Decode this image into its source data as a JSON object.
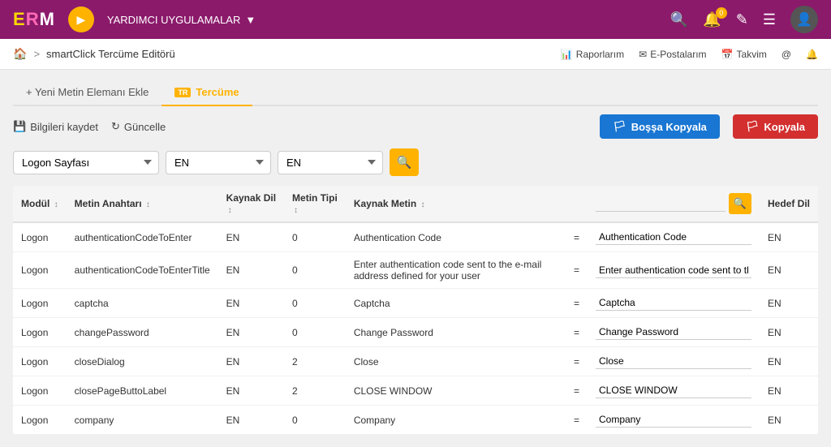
{
  "topnav": {
    "logo": "ERM",
    "yardimci": "YARDIMCI UYGULAMALAR",
    "icons": [
      "search",
      "bell",
      "pencil",
      "menu",
      "user"
    ],
    "bell_badge": "0"
  },
  "breadcrumb": {
    "home": "🏠",
    "sep": ">",
    "crumb": "smartClick Tercüme Editörü",
    "actions": [
      "Raporlarım",
      "E-Postalarım",
      "Takvim"
    ]
  },
  "tabs": [
    {
      "id": "yeni",
      "label": "+ Yeni Metin Elemanı Ekle",
      "active": false
    },
    {
      "id": "tercume",
      "label": "Tercüme",
      "active": true
    }
  ],
  "toolbar": {
    "save_label": "Bilgileri kaydet",
    "refresh_label": "Güncelle",
    "bossaKopya_label": "Boşşa Kopyala",
    "kopya_label": "Kopyala"
  },
  "filters": {
    "module_placeholder": "Logon Sayfası",
    "lang1_value": "EN",
    "lang2_value": "EN"
  },
  "table": {
    "headers": [
      "Modül",
      "Metin Anahtarı",
      "Kaynak Dil",
      "Metin Tipi",
      "Kaynak Metin",
      "=",
      "",
      "Hedef Dil"
    ],
    "rows": [
      {
        "modul": "Logon",
        "metin_anahtari": "authenticationCodeToEnter",
        "kaynak_dil": "EN",
        "metin_tipi": "0",
        "kaynak_metin": "Authentication Code",
        "eq": "=",
        "hedef_metin": "Authentication Code",
        "hedef_dil": "EN"
      },
      {
        "modul": "Logon",
        "metin_anahtari": "authenticationCodeToEnterTitle",
        "kaynak_dil": "EN",
        "metin_tipi": "0",
        "kaynak_metin": "Enter authentication code sent to the e-mail address defined for your user",
        "eq": "=",
        "hedef_metin": "Enter authentication code sent to the e-mail address defined for your user",
        "hedef_dil": "EN"
      },
      {
        "modul": "Logon",
        "metin_anahtari": "captcha",
        "kaynak_dil": "EN",
        "metin_tipi": "0",
        "kaynak_metin": "Captcha",
        "eq": "=",
        "hedef_metin": "Captcha",
        "hedef_dil": "EN"
      },
      {
        "modul": "Logon",
        "metin_anahtari": "changePassword",
        "kaynak_dil": "EN",
        "metin_tipi": "0",
        "kaynak_metin": "Change Password",
        "eq": "=",
        "hedef_metin": "Change Password",
        "hedef_dil": "EN"
      },
      {
        "modul": "Logon",
        "metin_anahtari": "closeDialog",
        "kaynak_dil": "EN",
        "metin_tipi": "2",
        "kaynak_metin": "Close",
        "eq": "=",
        "hedef_metin": "Close",
        "hedef_dil": "EN"
      },
      {
        "modul": "Logon",
        "metin_anahtari": "closePageButtoLabel",
        "kaynak_dil": "EN",
        "metin_tipi": "2",
        "kaynak_metin": "CLOSE WINDOW",
        "eq": "=",
        "hedef_metin": "CLOSE WINDOW",
        "hedef_dil": "EN"
      },
      {
        "modul": "Logon",
        "metin_anahtari": "company",
        "kaynak_dil": "EN",
        "metin_tipi": "0",
        "kaynak_metin": "Company",
        "eq": "=",
        "hedef_metin": "Company",
        "hedef_dil": "EN"
      }
    ]
  }
}
